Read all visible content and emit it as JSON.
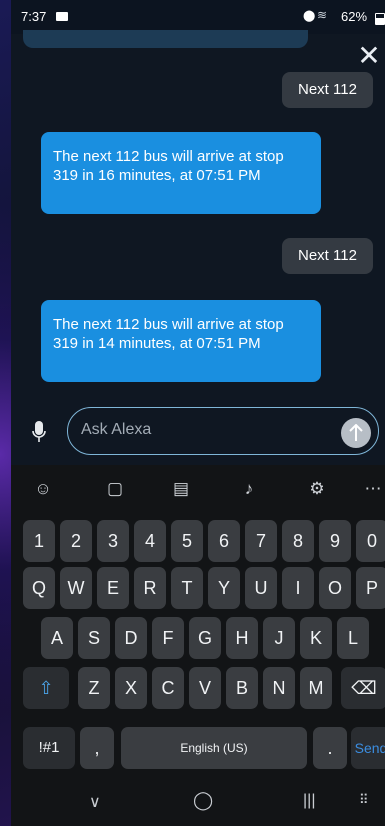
{
  "status": {
    "time": "7:37",
    "battery": "62%"
  },
  "chat": {
    "messages": [
      {
        "from": "user",
        "text": "Next 112"
      },
      {
        "from": "alexa",
        "text": "The next 112 bus will arrive at stop 319 in 16 minutes, at 07:51 PM"
      },
      {
        "from": "user",
        "text": "Next 112"
      },
      {
        "from": "alexa",
        "text": "The next 112 bus will arrive at stop 319 in 14 minutes, at 07:51 PM"
      }
    ]
  },
  "input": {
    "placeholder": "Ask Alexa"
  },
  "keyboard": {
    "number_row": [
      "1",
      "2",
      "3",
      "4",
      "5",
      "6",
      "7",
      "8",
      "9",
      "0"
    ],
    "row1": [
      "Q",
      "W",
      "E",
      "R",
      "T",
      "Y",
      "U",
      "I",
      "O",
      "P"
    ],
    "row2": [
      "A",
      "S",
      "D",
      "F",
      "G",
      "H",
      "J",
      "K",
      "L"
    ],
    "row3": [
      "Z",
      "X",
      "C",
      "V",
      "B",
      "N",
      "M"
    ],
    "symbols_label": "!#1",
    "comma": ",",
    "space_label": "English (US)",
    "period": ".",
    "send_label": "Send"
  },
  "colors": {
    "alexa_bubble": "#1a8fe0",
    "user_bubble": "#343a42",
    "send_text": "#3b8de0"
  },
  "icons": [
    "close-icon",
    "mic-icon",
    "send-arrow-icon",
    "emoji-icon",
    "clipboard-icon",
    "sticker-icon",
    "voice-icon",
    "settings-icon",
    "more-icon",
    "shift-icon",
    "backspace-icon",
    "back-nav-icon",
    "home-nav-icon",
    "recents-nav-icon",
    "keyboard-switch-icon"
  ]
}
